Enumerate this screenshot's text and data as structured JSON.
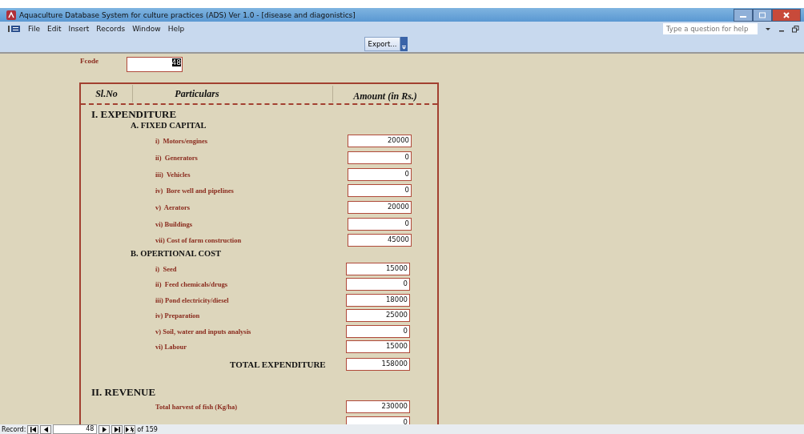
{
  "window": {
    "title": "Aquaculture Database System for culture practices (ADS) Ver 1.0 - [disease and diagonistics]"
  },
  "menu": [
    "File",
    "Edit",
    "Insert",
    "Records",
    "Window",
    "Help"
  ],
  "help_search": {
    "placeholder": "Type a question for help"
  },
  "toolbar": {
    "export_button": "Export..."
  },
  "fcode": {
    "label": "Fcode",
    "value": "48"
  },
  "columns": [
    "Sl.No",
    "Particulars",
    "Amount (in Rs.)"
  ],
  "sections": [
    {
      "title": "I. EXPENDITURE",
      "groups": [
        {
          "title": "A. FIXED CAPITAL",
          "items": [
            {
              "label": "i)  Motors/engines",
              "value": "20000"
            },
            {
              "label": "ii)  Generators",
              "value": "0"
            },
            {
              "label": "iii)  Vehicles",
              "value": "0"
            },
            {
              "label": "iv)  Bore well and pipelines",
              "value": "0"
            },
            {
              "label": "v)  Aerators",
              "value": "20000"
            },
            {
              "label": "vi) Buildings",
              "value": "0"
            },
            {
              "label": "vii) Cost of farm construction",
              "value": "45000"
            }
          ]
        },
        {
          "title": "B. OPERTIONAL COST",
          "items": [
            {
              "label": "i)  Seed",
              "value": "15000"
            },
            {
              "label": "ii)  Feed chemicals/drugs",
              "value": "0"
            },
            {
              "label": "iii) Pond electricity/diesel",
              "value": "18000"
            },
            {
              "label": "iv) Preparation",
              "value": "25000"
            },
            {
              "label": "v) Soil, water and inputs analysis",
              "value": "0"
            },
            {
              "label": "vi) Labour",
              "value": "15000"
            }
          ]
        }
      ],
      "total": {
        "label": "TOTAL EXPENDITURE",
        "value": "158000"
      }
    },
    {
      "title": "II. REVENUE",
      "groups": [
        {
          "items": [
            {
              "label": "Total harvest of fish (Kg/ha)",
              "value": "230000"
            },
            {
              "value": "0"
            }
          ]
        }
      ]
    }
  ],
  "record_nav": {
    "label": "Record:",
    "current": "48",
    "total": "of  159"
  }
}
